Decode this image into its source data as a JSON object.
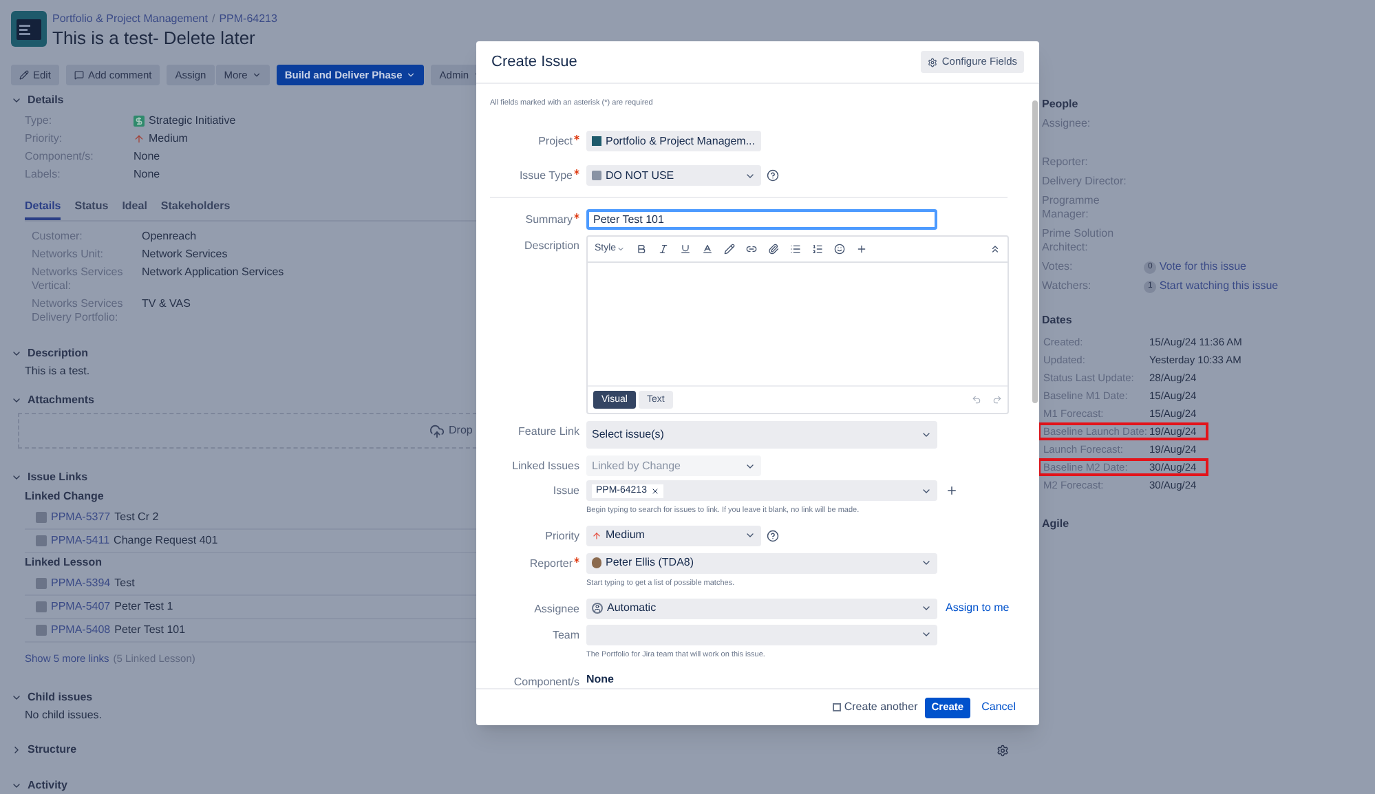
{
  "header": {
    "breadcrumb": [
      "Portfolio & Project Management",
      "PPM-64213"
    ],
    "separator": "/",
    "title": "This is a test- Delete later"
  },
  "toolbar": [
    {
      "kind": "edit",
      "label": "Edit"
    },
    {
      "kind": "comment",
      "label": "Add comment"
    },
    {
      "kind": "plain",
      "label": "Assign"
    },
    {
      "kind": "dropdown",
      "label": "More"
    },
    {
      "kind": "primary",
      "label": "Build and Deliver Phase"
    },
    {
      "kind": "dropdown",
      "label": "Admin"
    }
  ],
  "details": {
    "heading": "Details",
    "expanded": true,
    "fields": [
      {
        "kind": "initiative",
        "label": "Type:",
        "value": "Strategic Initiative"
      },
      {
        "kind": "priority",
        "label": "Priority:",
        "value": "Medium"
      },
      {
        "kind": "plain",
        "label": "Component/s:",
        "value": "None"
      },
      {
        "kind": "plain",
        "label": "Labels:",
        "value": "None"
      }
    ]
  },
  "tabs": [
    {
      "label": "Details",
      "selected": true
    },
    {
      "label": "Status",
      "selected": false
    },
    {
      "label": "Ideal",
      "selected": false
    },
    {
      "label": "Stakeholders",
      "selected": false
    }
  ],
  "tab_fields": [
    {
      "label": "Customer:",
      "value": "Openreach"
    },
    {
      "label": "Networks Unit:",
      "value": "Network Services"
    },
    {
      "label": "Networks Services Vertical:",
      "value": "Network Application Services"
    },
    {
      "label": "Networks Services Delivery Portfolio:",
      "value": "TV & VAS"
    }
  ],
  "description": {
    "heading": "Description",
    "expanded": true,
    "text": "This is a test."
  },
  "attachments": {
    "heading": "Attachments",
    "expanded": true,
    "drop_text": "Drop"
  },
  "issue_links": {
    "heading": "Issue Links",
    "expanded": true,
    "groups": [
      {
        "title": "Linked Change",
        "items": [
          {
            "key": "PPMA-5377",
            "summary": "Test Cr 2"
          },
          {
            "key": "PPMA-5411",
            "summary": "Change Request 401"
          }
        ]
      },
      {
        "title": "Linked Lesson",
        "items": [
          {
            "key": "PPMA-5394",
            "summary": "Test"
          },
          {
            "key": "PPMA-5407",
            "summary": "Peter Test 1"
          },
          {
            "key": "PPMA-5408",
            "summary": "Peter Test 101"
          }
        ]
      }
    ],
    "show_more": "Show 5 more links",
    "show_more_note": "(5 Linked Lesson)"
  },
  "child_issues": {
    "heading": "Child issues",
    "expanded": true,
    "text": "No child issues."
  },
  "structure": {
    "heading": "Structure",
    "expanded": false
  },
  "activity": {
    "heading": "Activity",
    "expanded": true
  },
  "people": {
    "heading": "People",
    "fields": [
      {
        "kind": "tall",
        "label": "Assignee:"
      },
      {
        "kind": "plain",
        "label": "Reporter:"
      },
      {
        "kind": "plain",
        "label": "Delivery Director:"
      },
      {
        "kind": "plain",
        "label": "Programme Manager:"
      },
      {
        "kind": "plain",
        "label": "Prime Solution Architect:"
      },
      {
        "kind": "count",
        "label": "Votes:",
        "count": "0",
        "link": "Vote for this issue"
      },
      {
        "kind": "count",
        "label": "Watchers:",
        "count": "1",
        "link": "Start watching this issue"
      }
    ]
  },
  "dates": {
    "heading": "Dates",
    "fields": [
      {
        "label": "Created:",
        "value": "15/Aug/24 11:36 AM",
        "highlighted": false
      },
      {
        "label": "Updated:",
        "value": "Yesterday 10:33 AM",
        "highlighted": false
      },
      {
        "label": "Status Last Update:",
        "value": "28/Aug/24",
        "highlighted": false
      },
      {
        "label": "Baseline M1 Date:",
        "value": "15/Aug/24",
        "highlighted": false
      },
      {
        "label": "M1 Forecast:",
        "value": "15/Aug/24",
        "highlighted": false
      },
      {
        "label": "Baseline Launch Date:",
        "value": "19/Aug/24",
        "highlighted": true
      },
      {
        "label": "Launch Forecast:",
        "value": "19/Aug/24",
        "highlighted": false
      },
      {
        "label": "Baseline M2 Date:",
        "value": "30/Aug/24",
        "highlighted": true
      },
      {
        "label": "M2 Forecast:",
        "value": "30/Aug/24",
        "highlighted": false
      }
    ]
  },
  "agile": {
    "heading": "Agile"
  },
  "modal": {
    "title": "Create Issue",
    "configure_button": "Configure Fields",
    "required_note": "All fields marked with an asterisk (*) are required",
    "fields": [
      {
        "kind": "project",
        "label": "Project",
        "required": true,
        "value": "Portfolio & Project Managem..."
      },
      {
        "kind": "issue-type",
        "label": "Issue Type",
        "required": true,
        "value": "DO NOT USE"
      },
      {
        "kind": "divider"
      },
      {
        "kind": "summary",
        "label": "Summary",
        "required": true,
        "value": "Peter Test 101"
      },
      {
        "kind": "editor",
        "label": "Description",
        "required": false,
        "style": "Style",
        "modes": [
          {
            "label": "Visual",
            "selected": true
          },
          {
            "label": "Text",
            "selected": false
          }
        ]
      },
      {
        "kind": "picker",
        "label": "Feature Link",
        "required": false,
        "placeholder": "Select issue(s)"
      },
      {
        "kind": "link-type",
        "label": "Linked Issues",
        "required": false,
        "value": "Linked by Change",
        "disabled": true
      },
      {
        "kind": "issue-token",
        "label": "Issue",
        "required": false,
        "tokens": [
          "PPM-64213"
        ],
        "hint": "Begin typing to search for issues to link. If you leave it blank, no link will be made."
      },
      {
        "kind": "priority",
        "label": "Priority",
        "required": false,
        "value": "Medium"
      },
      {
        "kind": "user",
        "label": "Reporter",
        "required": true,
        "value": "Peter Ellis (TDA8)",
        "hint": "Start typing to get a list of possible matches."
      },
      {
        "kind": "assignee",
        "label": "Assignee",
        "required": false,
        "value": "Automatic",
        "link": "Assign to me"
      },
      {
        "kind": "team",
        "label": "Team",
        "required": false,
        "hint": "The Portfolio for Jira team that will work on this issue."
      },
      {
        "kind": "static",
        "label": "Component/s",
        "required": false,
        "value": "None"
      }
    ],
    "create_another": {
      "label": "Create another",
      "checked": false
    },
    "create_button": "Create",
    "cancel": "Cancel"
  }
}
